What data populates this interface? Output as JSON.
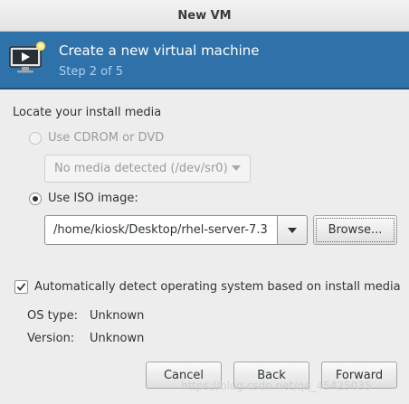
{
  "window": {
    "title": "New VM"
  },
  "banner": {
    "heading": "Create a new virtual machine",
    "step": "Step 2 of 5",
    "icon": "computer-monitor-play-icon"
  },
  "install_media": {
    "section_label": "Locate your install media",
    "cdrom": {
      "label": "Use CDROM or DVD",
      "enabled": false,
      "selected": false,
      "combo_value": "No media detected (/dev/sr0)"
    },
    "iso": {
      "label": "Use ISO image:",
      "selected": true,
      "path": "/home/kiosk/Desktop/rhel-server-7.3",
      "browse_label": "Browse..."
    }
  },
  "os_detect": {
    "label": "Automatically detect operating system based on install media",
    "checked": true,
    "os_type_label": "OS type:",
    "os_type_value": "Unknown",
    "version_label": "Version:",
    "version_value": "Unknown"
  },
  "buttons": {
    "cancel": "Cancel",
    "back": "Back",
    "forward": "Forward"
  },
  "watermark": "https://blog.csdn.net/qq_45425035",
  "colors": {
    "banner": "#2f72a9",
    "banner_step_text": "#a9d2f2",
    "window_bg": "#ededed"
  }
}
